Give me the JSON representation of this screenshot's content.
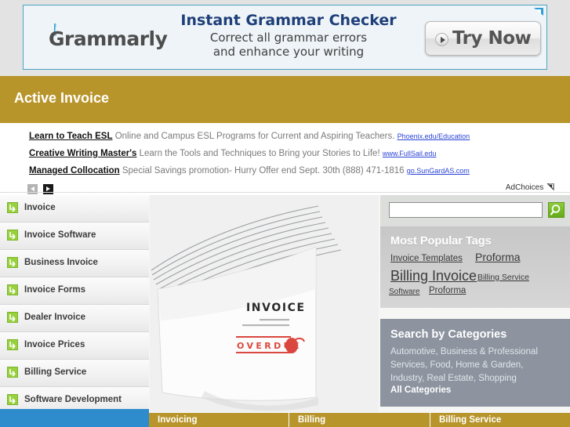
{
  "banner_ad": {
    "brand": "Grammarly",
    "headline": "Instant Grammar Checker",
    "subline_1": "Correct all grammar errors",
    "subline_2": "and enhance your writing",
    "cta_label": "Try Now",
    "icon_quill": "quill-icon",
    "icon_play": "play-icon",
    "icon_adchoices_corner": "adchoices-triangle-icon"
  },
  "header": {
    "title": "Active Invoice",
    "bg_color": "#b8952b"
  },
  "text_ads": {
    "items": [
      {
        "title": "Learn to Teach ESL",
        "description": "Online and Campus ESL Programs for Current and Aspiring Teachers.",
        "url": "Phoenix.edu/Education"
      },
      {
        "title": "Creative Writing Master's",
        "description": "Learn the Tools and Techniques to Bring your Stories to Life!",
        "url": "www.FullSail.edu"
      },
      {
        "title": "Managed Collocation",
        "description": "Special Savings promotion- Hurry Offer end Sept. 30th (888) 471-1816",
        "url": "go.SunGardAS.com"
      }
    ],
    "prev_icon": "arrow-left-icon",
    "next_icon": "arrow-right-icon",
    "adchoices_label": "AdChoices",
    "adchoices_icon": "adchoices-triangle-icon"
  },
  "sidebar": {
    "items": [
      {
        "label": "Invoice",
        "icon": "arrow-down-right-icon"
      },
      {
        "label": "Invoice Software",
        "icon": "arrow-down-right-icon"
      },
      {
        "label": "Business Invoice",
        "icon": "arrow-down-right-icon"
      },
      {
        "label": "Invoice Forms",
        "icon": "arrow-down-right-icon"
      },
      {
        "label": "Dealer Invoice",
        "icon": "arrow-down-right-icon"
      },
      {
        "label": "Invoice Prices",
        "icon": "arrow-down-right-icon"
      },
      {
        "label": "Billing Service",
        "icon": "arrow-down-right-icon"
      },
      {
        "label": "Software Development",
        "icon": "arrow-down-right-icon"
      }
    ],
    "accent_color": "#2e8bcc"
  },
  "hero_image": {
    "alt": "stack-of-invoice-papers",
    "document_label": "INVOICE",
    "stamp_label": "OVERDUE",
    "stamp_color": "#d7342a"
  },
  "search": {
    "value": "",
    "placeholder": "",
    "button_icon": "magnifier-icon",
    "button_color": "#7cbf2e"
  },
  "tags_panel": {
    "title": "Most Popular Tags",
    "tags": [
      "Invoice Templates",
      "Proforma",
      "Billing Invoice",
      "Billing Service",
      "Software",
      "Proforma"
    ]
  },
  "categories_panel": {
    "title": "Search by Categories",
    "body": "Automotive, Business & Professional Services, Food, Home & Garden, Industry, Real Estate, Shopping",
    "all_link": "All Categories",
    "bg_color": "#8d94a0"
  },
  "footer": {
    "cells": [
      "Invoicing",
      "Billing",
      "Billing Service"
    ],
    "bg_color": "#b8952b"
  }
}
